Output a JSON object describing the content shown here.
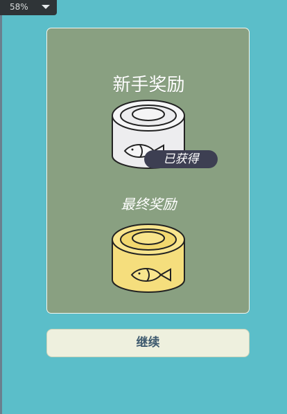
{
  "zoom": {
    "value": "58%"
  },
  "reward_panel": {
    "title": "新手奖励",
    "obtained_badge": "已获得",
    "final_reward_label": "最终奖励"
  },
  "icons": {
    "starter_reward": "tuna-can-icon",
    "final_reward": "golden-tuna-can-icon"
  },
  "colors": {
    "background": "#5bbec9",
    "panel": "#89a081",
    "badge": "#3d3f52",
    "silver_can": "#ededef",
    "gold_can": "#f5de7d",
    "button": "#eef0de",
    "button_text": "#3e5a6e"
  },
  "continue_button": {
    "label": "继续"
  }
}
